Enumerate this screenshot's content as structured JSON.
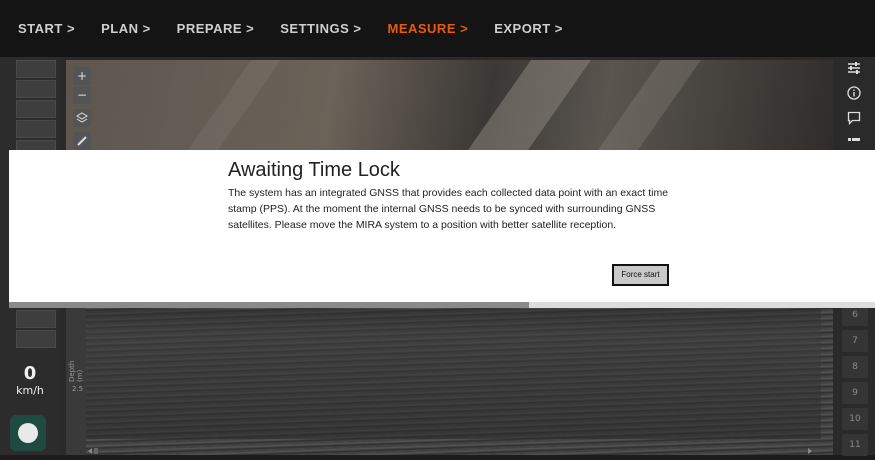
{
  "nav": {
    "steps": [
      {
        "label": "START >"
      },
      {
        "label": "PLAN >"
      },
      {
        "label": "PREPARE >"
      },
      {
        "label": "SETTINGS >"
      },
      {
        "label": "MEASURE >"
      },
      {
        "label": "EXPORT >"
      }
    ],
    "active_index": 4,
    "active_color": "#e65b10"
  },
  "map": {
    "zoom_in": "+",
    "zoom_out": "−"
  },
  "radar": {
    "depth_label": "Depth (m)",
    "depth_tick": "2.5"
  },
  "speed": {
    "value": "0",
    "unit": "km/h"
  },
  "right_panel": {
    "icons": [
      "sliders-icon",
      "info-icon",
      "comment-icon",
      "list-icon"
    ],
    "page_numbers": [
      "6",
      "7",
      "8",
      "9",
      "10",
      "11"
    ]
  },
  "modal": {
    "title": "Awaiting Time Lock",
    "body": "The system has an integrated GNSS that provides each collected data point with an exact time stamp (PPS). At the moment the internal GNSS needs to be synced with surrounding GNSS satellites. Please move the MIRA system to a position with better satellite reception.",
    "force_start_label": "Force start",
    "progress": 0.6
  }
}
